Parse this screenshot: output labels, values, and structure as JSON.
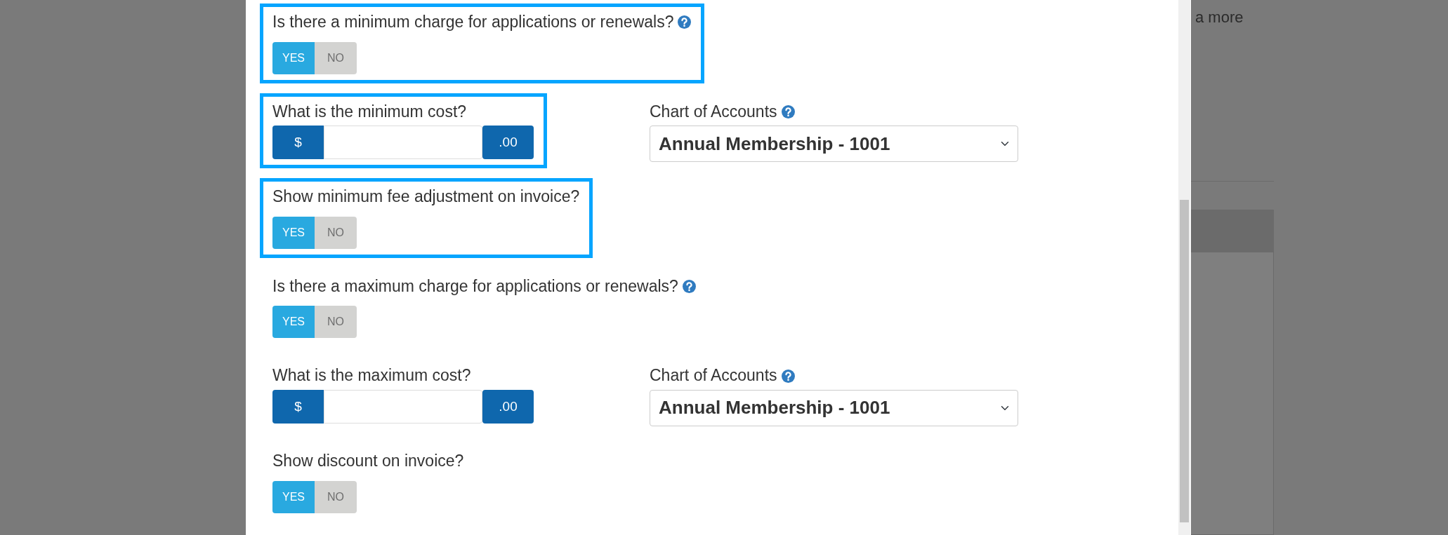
{
  "background": {
    "text": "a more"
  },
  "fields": [
    {
      "kind": "toggle",
      "label": "Is there a minimum charge for applications or renewals?",
      "help": true,
      "highlighted": true,
      "options": [
        {
          "label": "YES",
          "selected": true
        },
        {
          "label": "NO",
          "selected": false
        }
      ]
    },
    {
      "kind": "money",
      "label": "What is the minimum cost?",
      "help": false,
      "highlighted": true,
      "prefix": "$",
      "suffix": ".00",
      "account": {
        "label": "Chart of Accounts",
        "help": true,
        "value": "Annual Membership - 1001"
      }
    },
    {
      "kind": "toggle",
      "label": "Show minimum fee adjustment on invoice?",
      "help": false,
      "highlighted": true,
      "options": [
        {
          "label": "YES",
          "selected": true
        },
        {
          "label": "NO",
          "selected": false
        }
      ]
    },
    {
      "kind": "toggle",
      "label": "Is there a maximum charge for applications or renewals?",
      "help": true,
      "highlighted": false,
      "options": [
        {
          "label": "YES",
          "selected": true
        },
        {
          "label": "NO",
          "selected": false
        }
      ]
    },
    {
      "kind": "money",
      "label": "What is the maximum cost?",
      "help": false,
      "highlighted": false,
      "prefix": "$",
      "suffix": ".00",
      "account": {
        "label": "Chart of Accounts",
        "help": true,
        "value": "Annual Membership - 1001"
      }
    },
    {
      "kind": "toggle",
      "label": "Show discount on invoice?",
      "help": false,
      "highlighted": false,
      "options": [
        {
          "label": "YES",
          "selected": true
        },
        {
          "label": "NO",
          "selected": false
        }
      ]
    }
  ]
}
